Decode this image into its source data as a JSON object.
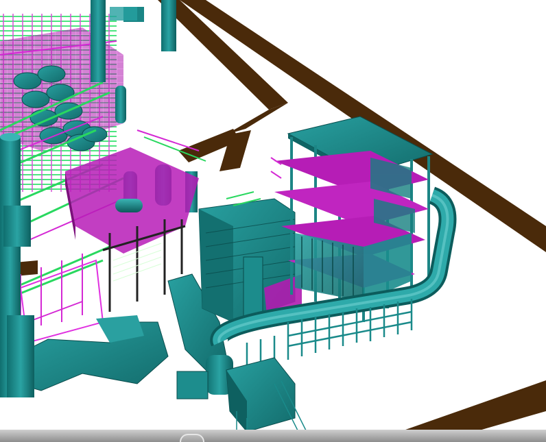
{
  "view": {
    "type": "3d-plant-model",
    "colors": {
      "background": "#ffffff",
      "road": "#4a2a0a",
      "equipment": "#1f8f8f",
      "structure_magenta": "#c81ec8",
      "pipe_green": "#22d05a",
      "frame_dark": "#2a2a2a"
    },
    "chrome": {
      "top_bar_color": "#8a8a8a",
      "bottom_bar_color": "#b0b0b0"
    }
  }
}
